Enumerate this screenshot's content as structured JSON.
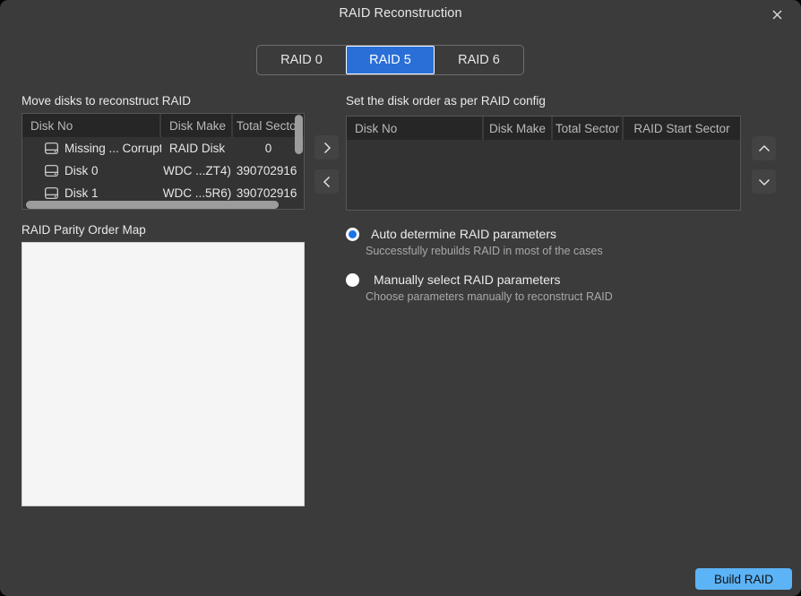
{
  "window": {
    "title": "RAID Reconstruction",
    "close_icon": "close-icon",
    "background": "#3b3b3b",
    "accent": "#2a6fd8",
    "build_accent": "#5cb3f5"
  },
  "tabs": [
    {
      "label": "RAID 0",
      "active": false
    },
    {
      "label": "RAID 5",
      "active": true
    },
    {
      "label": "RAID 6",
      "active": false
    }
  ],
  "left_panel": {
    "heading": "Move disks to reconstruct RAID",
    "columns": [
      "Disk No",
      "Disk Make",
      "Total Sector"
    ],
    "rows": [
      {
        "disk_no": "Missing ... Corrupt",
        "disk_make": "RAID Disk",
        "total_sector": "0"
      },
      {
        "disk_no": "Disk 0",
        "disk_make": "WDC ...ZT4)",
        "total_sector": "390702916 "
      },
      {
        "disk_no": "Disk 1",
        "disk_make": "WDC ...5R6)",
        "total_sector": "390702916 "
      }
    ]
  },
  "transfer_buttons": {
    "move_right_icon": "chevron-right-icon",
    "move_left_icon": "chevron-left-icon"
  },
  "right_panel": {
    "heading": "Set the disk order as per RAID config",
    "columns": [
      "Disk No",
      "Disk Make",
      "Total Sector",
      "RAID Start Sector"
    ],
    "rows": []
  },
  "order_buttons": {
    "move_up_icon": "chevron-up-icon",
    "move_down_icon": "chevron-down-icon"
  },
  "parity_map": {
    "heading": "RAID Parity Order Map",
    "content": ""
  },
  "raid_parameters": {
    "options": [
      {
        "label": "Auto determine RAID parameters",
        "description": "Successfully rebuilds RAID in most of the cases",
        "selected": true
      },
      {
        "label": "Manually select RAID parameters",
        "description": "Choose parameters manually to reconstruct RAID",
        "selected": false
      }
    ]
  },
  "footer": {
    "build_label": "Build RAID"
  }
}
